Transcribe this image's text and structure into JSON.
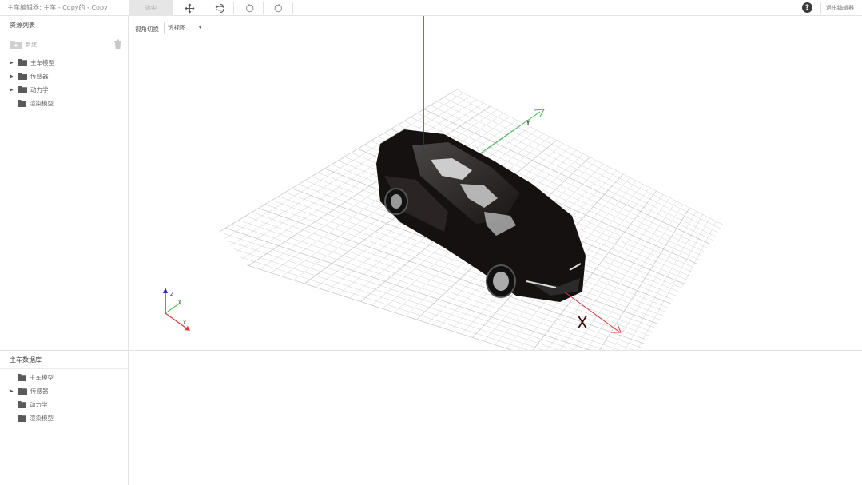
{
  "window": {
    "title": "主车编辑器: 主车 - Copy的 - Copy"
  },
  "toolbar": {
    "select_label": "选中",
    "tools": [
      "move-icon",
      "rotate-icon",
      "undo-icon",
      "redo-icon"
    ],
    "help_label": "?",
    "exit_label": "退出编辑器"
  },
  "resource_panel": {
    "title": "资源列表",
    "new_label": "新建",
    "items": [
      {
        "label": "主车模型",
        "expandable": true
      },
      {
        "label": "传感器",
        "expandable": true
      },
      {
        "label": "动力学",
        "expandable": true
      },
      {
        "label": "渲染模型",
        "expandable": false
      }
    ]
  },
  "library_panel": {
    "title": "主车数据库",
    "items": [
      {
        "label": "主车模型",
        "expandable": false
      },
      {
        "label": "传感器",
        "expandable": true
      },
      {
        "label": "动力学",
        "expandable": false
      },
      {
        "label": "渲染模型",
        "expandable": false
      }
    ]
  },
  "viewport": {
    "view_switch_label": "视角切换",
    "view_mode": "透视图",
    "axis_labels": {
      "x": "X",
      "y": "Y",
      "z": "Z"
    },
    "colors": {
      "x_axis": "#d83a3a",
      "y_axis": "#3cb84a",
      "z_axis": "#2b2fa8",
      "grid": "#c9c9c9",
      "car_body": "#1a1414"
    }
  }
}
